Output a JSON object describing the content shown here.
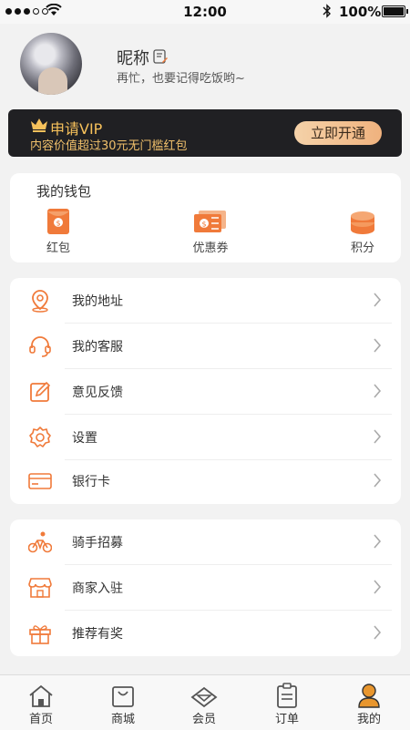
{
  "status_bar": {
    "time": "12:00",
    "battery": "100%"
  },
  "profile": {
    "nickname": "昵称",
    "signature": "再忙，也要记得吃饭哟~"
  },
  "vip": {
    "title": "申请VIP",
    "subtitle": "内容价值超过30元无门槛红包",
    "button": "立即开通"
  },
  "wallet": {
    "title": "我的钱包",
    "items": [
      {
        "label": "红包",
        "icon": "red-packet-icon"
      },
      {
        "label": "优惠券",
        "icon": "coupon-icon"
      },
      {
        "label": "积分",
        "icon": "coins-icon"
      }
    ]
  },
  "menu1": [
    {
      "label": "我的地址",
      "icon": "location-icon"
    },
    {
      "label": "我的客服",
      "icon": "headset-icon"
    },
    {
      "label": "意见反馈",
      "icon": "feedback-edit-icon"
    },
    {
      "label": "设置",
      "icon": "gear-icon"
    },
    {
      "label": "银行卡",
      "icon": "bank-card-icon"
    }
  ],
  "menu2": [
    {
      "label": "骑手招募",
      "icon": "bike-rider-icon"
    },
    {
      "label": "商家入驻",
      "icon": "store-icon"
    },
    {
      "label": "推荐有奖",
      "icon": "gift-icon"
    }
  ],
  "tabs": [
    {
      "label": "首页",
      "icon": "home-icon"
    },
    {
      "label": "商城",
      "icon": "shopping-bag-icon"
    },
    {
      "label": "会员",
      "icon": "diamond-icon"
    },
    {
      "label": "订单",
      "icon": "order-clipboard-icon"
    },
    {
      "label": "我的",
      "icon": "user-icon",
      "active": true
    }
  ],
  "colors": {
    "accent": "#f07a3a",
    "vip_gold": "#f6c15b",
    "vip_bg": "#202023"
  }
}
